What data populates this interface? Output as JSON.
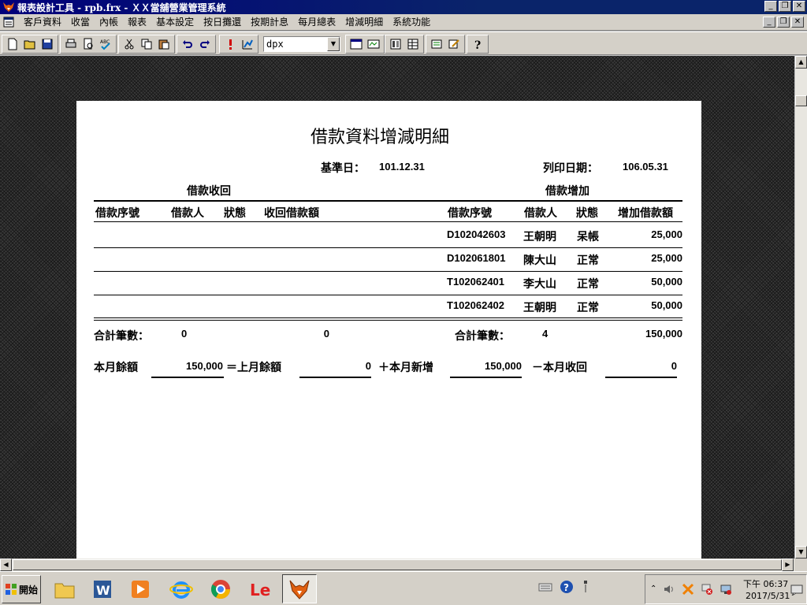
{
  "window": {
    "title": "報表設計工具 - rpb.frx - ＸＸ當舖營業管理系統"
  },
  "menu": {
    "items": [
      "客戶資料",
      "收當",
      "內帳",
      "報表",
      "基本設定",
      "按日攤還",
      "按期計息",
      "每月總表",
      "增減明細",
      "系統功能"
    ]
  },
  "toolbar": {
    "zoom_value": "dpx"
  },
  "report": {
    "title": "借款資料增減明細",
    "base_date_label": "基準日：",
    "base_date": "101.12.31",
    "print_date_label": "列印日期：",
    "print_date": "106.05.31",
    "left_section": "借款收回",
    "right_section": "借款增加",
    "left_headers": [
      "借款序號",
      "借款人",
      "狀態",
      "收回借款額"
    ],
    "right_headers": [
      "借款序號",
      "借款人",
      "狀態",
      "增加借款額"
    ],
    "rows": [
      {
        "id": "D102042603",
        "name": "王朝明",
        "status": "呆帳",
        "amount": "25,000"
      },
      {
        "id": "D102061801",
        "name": "陳大山",
        "status": "正常",
        "amount": "25,000"
      },
      {
        "id": "T102062401",
        "name": "李大山",
        "status": "正常",
        "amount": "50,000"
      },
      {
        "id": "T102062402",
        "name": "王朝明",
        "status": "正常",
        "amount": "50,000"
      }
    ],
    "total_label": "合計筆數：",
    "left_total_count": "0",
    "left_total_amount": "0",
    "right_total_label": "合計筆數：",
    "right_total_count": "4",
    "right_total_amount": "150,000",
    "balance_label": "本月餘額",
    "balance_value": "150,000",
    "prev_label": "＝上月餘額",
    "prev_value": "0",
    "new_label": "＋本月新增",
    "new_value": "150,000",
    "recover_label": "－本月收回",
    "recover_value": "0"
  },
  "taskbar": {
    "start_label": "開始",
    "clock_time": "下午 06:37",
    "clock_date": "2017/5/31"
  }
}
